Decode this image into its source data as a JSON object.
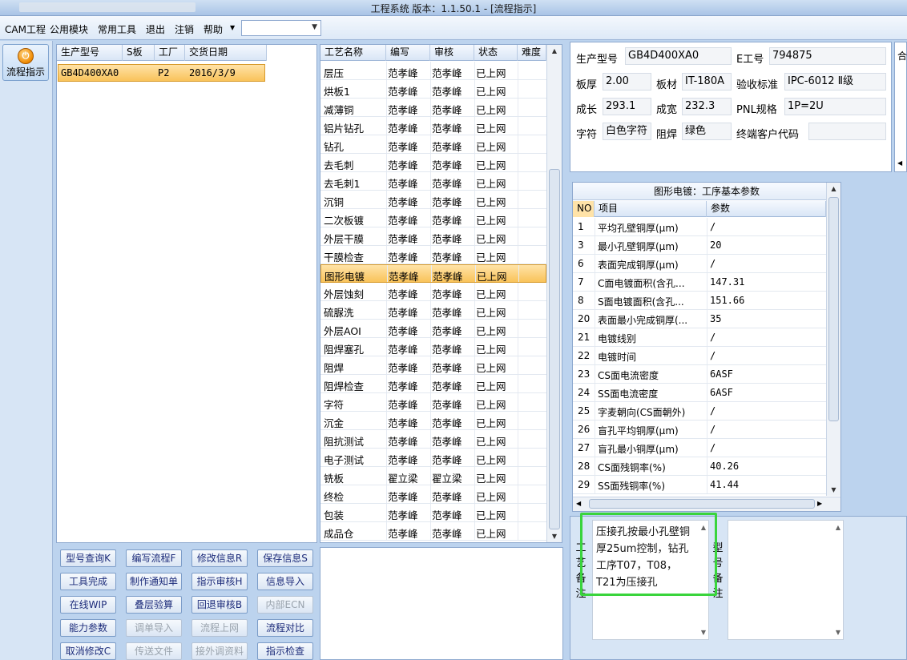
{
  "window": {
    "title": "工程系统   版本：1.1.50.1 - [流程指示]"
  },
  "menu": {
    "items": [
      "CAM工程",
      "公用模块",
      "常用工具",
      "退出",
      "注销",
      "帮助"
    ],
    "combo_value": ""
  },
  "launcher": {
    "button_label": "流程指示"
  },
  "orders": {
    "columns": [
      "生产型号",
      "S板",
      "工厂",
      "交货日期"
    ],
    "rows": [
      {
        "model": "GB4D400XA0",
        "s_board": "",
        "factory": "P2",
        "delivery": "2016/3/9"
      }
    ]
  },
  "process": {
    "columns": [
      "工艺名称",
      "编写",
      "审核",
      "状态",
      "难度"
    ],
    "selected_index": 11,
    "rows": [
      [
        "层压",
        "范孝峰",
        "范孝峰",
        "已上网"
      ],
      [
        "烘板1",
        "范孝峰",
        "范孝峰",
        "已上网"
      ],
      [
        "减薄铜",
        "范孝峰",
        "范孝峰",
        "已上网"
      ],
      [
        "铝片钻孔",
        "范孝峰",
        "范孝峰",
        "已上网"
      ],
      [
        "钻孔",
        "范孝峰",
        "范孝峰",
        "已上网"
      ],
      [
        "去毛刺",
        "范孝峰",
        "范孝峰",
        "已上网"
      ],
      [
        "去毛刺1",
        "范孝峰",
        "范孝峰",
        "已上网"
      ],
      [
        "沉铜",
        "范孝峰",
        "范孝峰",
        "已上网"
      ],
      [
        "二次板镀",
        "范孝峰",
        "范孝峰",
        "已上网"
      ],
      [
        "外层干膜",
        "范孝峰",
        "范孝峰",
        "已上网"
      ],
      [
        "干膜检查",
        "范孝峰",
        "范孝峰",
        "已上网"
      ],
      [
        "图形电镀",
        "范孝峰",
        "范孝峰",
        "已上网"
      ],
      [
        "外层蚀刻",
        "范孝峰",
        "范孝峰",
        "已上网"
      ],
      [
        "硫脲洗",
        "范孝峰",
        "范孝峰",
        "已上网"
      ],
      [
        "外层AOI",
        "范孝峰",
        "范孝峰",
        "已上网"
      ],
      [
        "阻焊塞孔",
        "范孝峰",
        "范孝峰",
        "已上网"
      ],
      [
        "阻焊",
        "范孝峰",
        "范孝峰",
        "已上网"
      ],
      [
        "阻焊检查",
        "范孝峰",
        "范孝峰",
        "已上网"
      ],
      [
        "字符",
        "范孝峰",
        "范孝峰",
        "已上网"
      ],
      [
        "沉金",
        "范孝峰",
        "范孝峰",
        "已上网"
      ],
      [
        "阻抗测试",
        "范孝峰",
        "范孝峰",
        "已上网"
      ],
      [
        "电子测试",
        "范孝峰",
        "范孝峰",
        "已上网"
      ],
      [
        "铣板",
        "翟立梁",
        "翟立梁",
        "已上网"
      ],
      [
        "终检",
        "范孝峰",
        "范孝峰",
        "已上网"
      ],
      [
        "包装",
        "范孝峰",
        "范孝峰",
        "已上网"
      ],
      [
        "成品仓",
        "范孝峰",
        "范孝峰",
        "已上网"
      ]
    ]
  },
  "buttons": [
    {
      "label": "型号查询K",
      "enabled": true
    },
    {
      "label": "编写流程F",
      "enabled": true
    },
    {
      "label": "修改信息R",
      "enabled": true
    },
    {
      "label": "保存信息S",
      "enabled": true
    },
    {
      "label": "工具完成",
      "enabled": true
    },
    {
      "label": "制作通知单",
      "enabled": true
    },
    {
      "label": "指示审核H",
      "enabled": true
    },
    {
      "label": "信息导入",
      "enabled": true
    },
    {
      "label": "在线WIP",
      "enabled": true
    },
    {
      "label": "叠层验算",
      "enabled": true
    },
    {
      "label": "回退审核B",
      "enabled": true
    },
    {
      "label": "内部ECN",
      "enabled": false
    },
    {
      "label": "能力参数",
      "enabled": true
    },
    {
      "label": "调单导入",
      "enabled": false
    },
    {
      "label": "流程上网",
      "enabled": false
    },
    {
      "label": "流程对比",
      "enabled": true
    },
    {
      "label": "取消修改C",
      "enabled": true
    },
    {
      "label": "传送文件",
      "enabled": false
    },
    {
      "label": "接外调资料",
      "enabled": false
    },
    {
      "label": "指示检查",
      "enabled": true
    }
  ],
  "info": {
    "model_label": "生产型号",
    "model": "GB4D400XA0",
    "e_label": "E工号",
    "e_no": "794875",
    "thick_label": "板厚",
    "thick": "2.00",
    "material_label": "板材",
    "material": "IT-180A",
    "std_label": "验收标准",
    "std": "IPC-6012 Ⅱ级",
    "length_label": "成长",
    "length": "293.1",
    "width_label": "成宽",
    "width": "232.3",
    "pnl_label": "PNL规格",
    "pnl": "1P=2U",
    "char_label": "字符",
    "char": "白色字符",
    "mask_label": "阻焊",
    "mask": "绿色",
    "cust_label": "终端客户代码",
    "cust": "",
    "right_stub": "合"
  },
  "params": {
    "caption": "图形电镀：工序基本参数",
    "columns": [
      "NO",
      "项目",
      "参数"
    ],
    "rows": [
      [
        "1",
        "平均孔壁铜厚(μm)",
        "/"
      ],
      [
        "3",
        "最小孔壁铜厚(μm)",
        "20"
      ],
      [
        "6",
        "表面完成铜厚(μm)",
        "/"
      ],
      [
        "7",
        "C面电镀面积(含孔...",
        "147.31"
      ],
      [
        "8",
        "S面电镀面积(含孔...",
        "151.66"
      ],
      [
        "20",
        "表面最小完成铜厚(...",
        "35"
      ],
      [
        "21",
        "电镀线别",
        "/"
      ],
      [
        "22",
        "电镀时间",
        "/"
      ],
      [
        "23",
        "CS面电流密度",
        "6ASF"
      ],
      [
        "24",
        "SS面电流密度",
        "6ASF"
      ],
      [
        "25",
        "字麦朝向(CS面朝外)",
        "/"
      ],
      [
        "26",
        "盲孔平均铜厚(μm)",
        "/"
      ],
      [
        "27",
        "盲孔最小铜厚(μm)",
        "/"
      ],
      [
        "28",
        "CS面残铜率(%)",
        "40.26"
      ],
      [
        "29",
        "SS面残铜率(%)",
        "41.44"
      ]
    ]
  },
  "notes": {
    "process_label": "工艺备注",
    "process_note": "压接孔按最小孔壁铜厚25um控制，钻孔工序T07，T08，T21为压接孔",
    "model_label": "型号备注",
    "model_note": ""
  }
}
